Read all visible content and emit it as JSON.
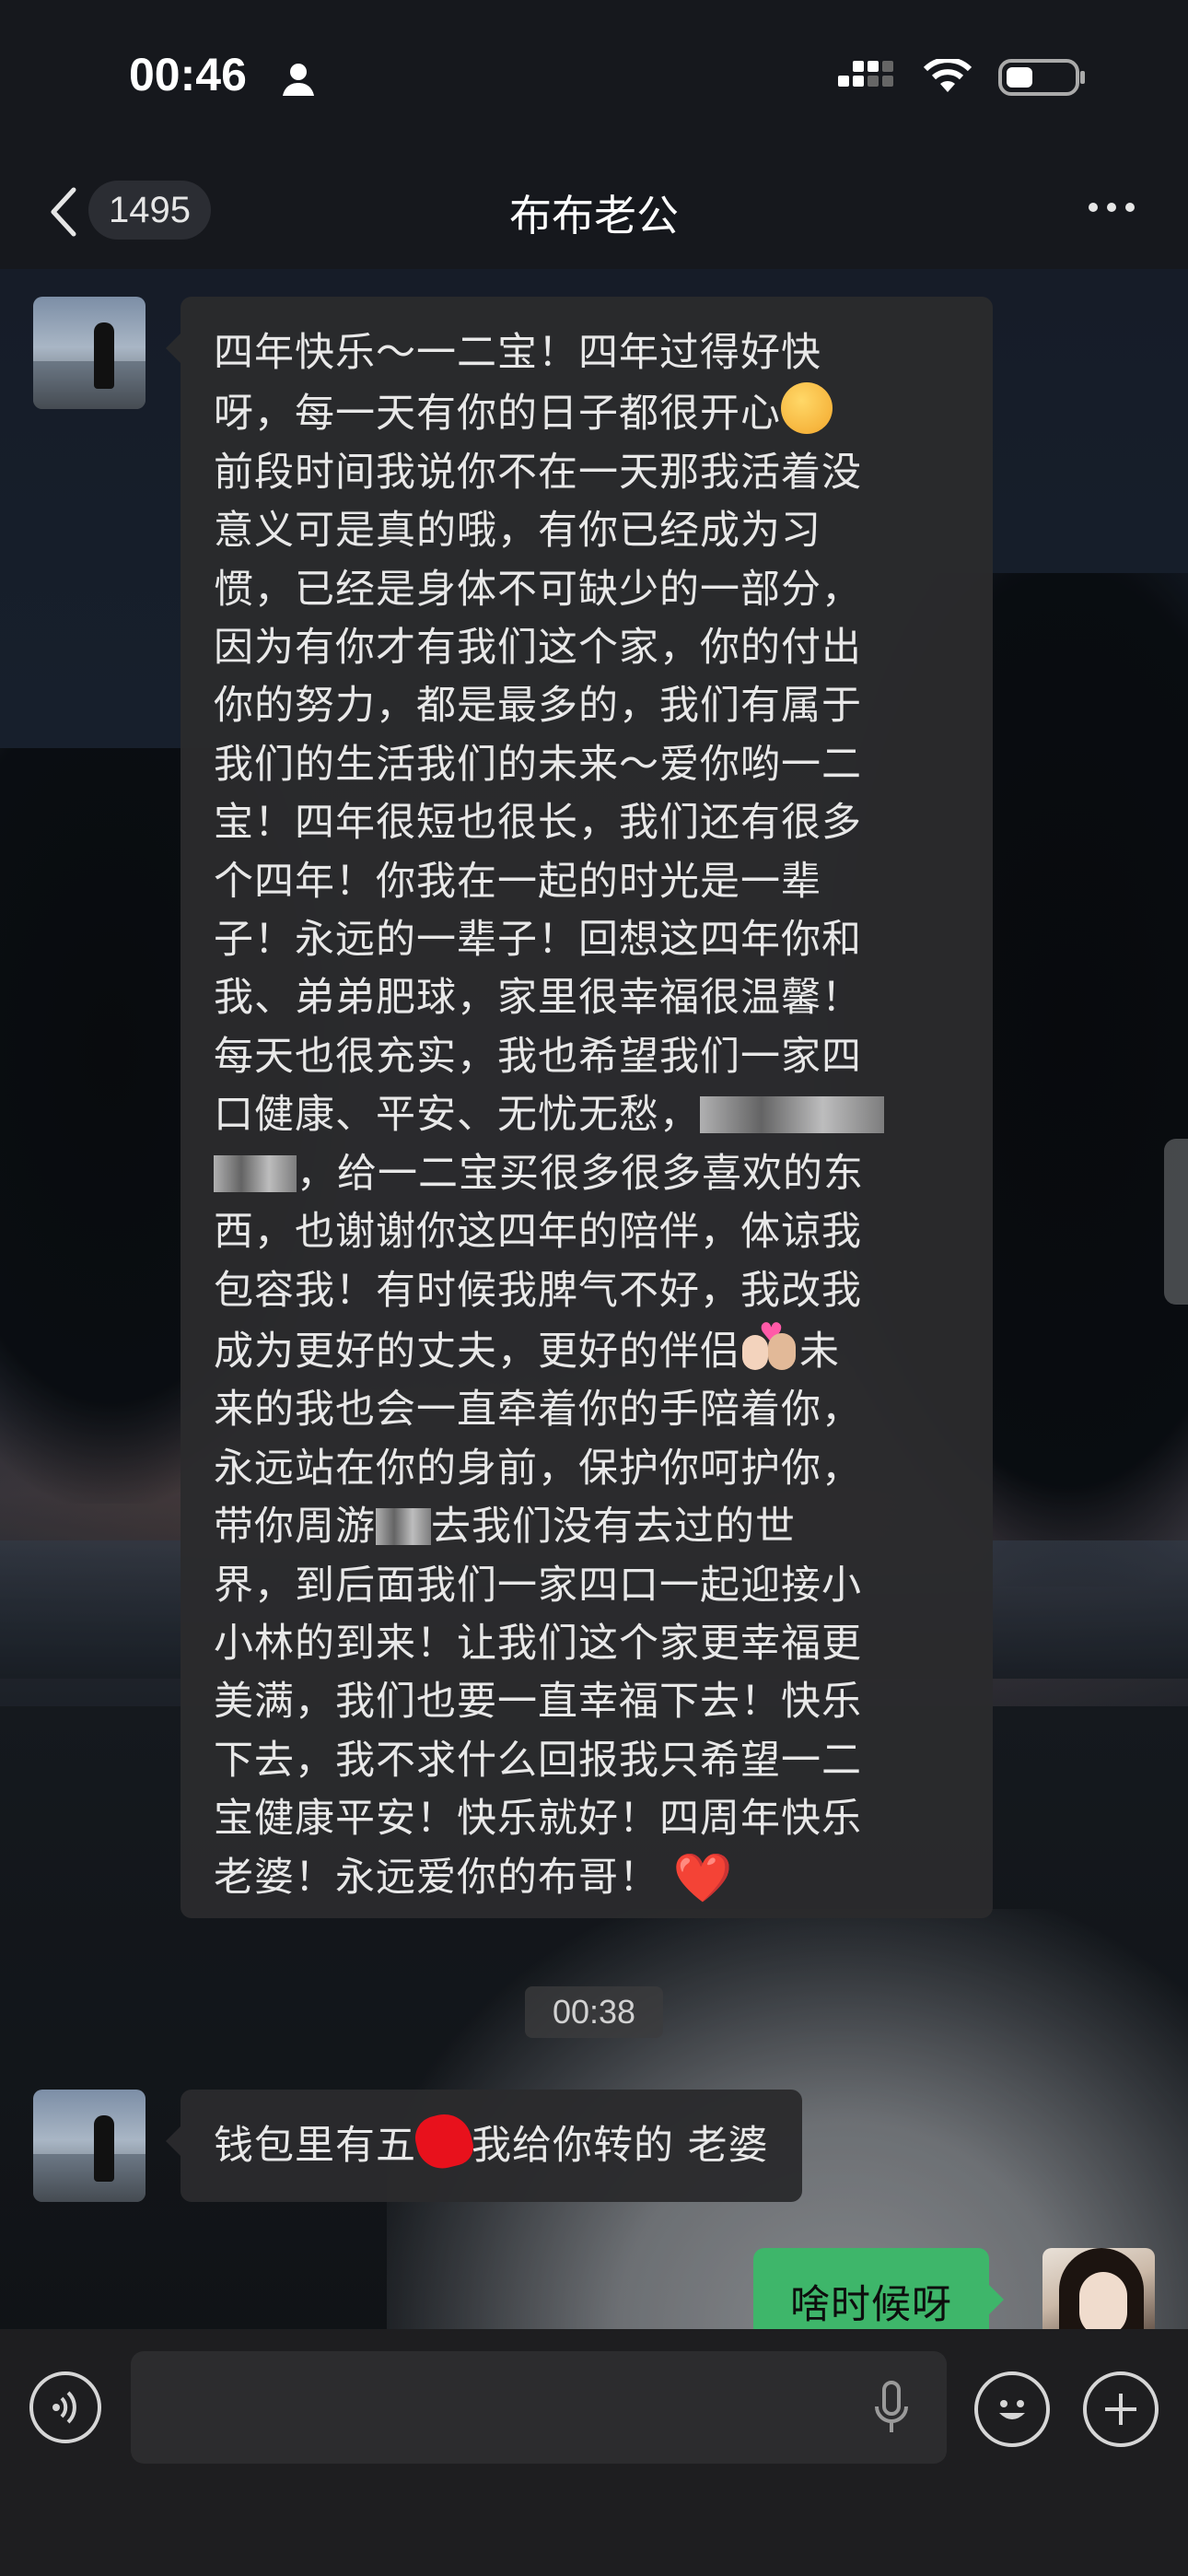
{
  "status_bar": {
    "time": "00:46"
  },
  "nav": {
    "back_count": "1495",
    "title": "布布老公"
  },
  "messages": {
    "long_lines": [
      "四年快乐～一二宝！四年过得好快",
      "呀，每一天有你的日子都很开心",
      "前段时间我说你不在一天那我活着没",
      "意义可是真的哦，有你已经成为习",
      "惯，已经是身体不可缺少的一部分，",
      "因为有你才有我们这个家，你的付出",
      "你的努力，都是最多的，我们有属于",
      "我们的生活我们的未来～爱你哟一二",
      "宝！四年很短也很长，我们还有很多",
      "个四年！你我在一起的时光是一辈",
      "子！永远的一辈子！回想这四年你和",
      "我、弟弟肥球，家里很幸福很温馨！",
      "每天也很充实，我也希望我们一家四",
      "口健康、平安、无忧无愁，",
      "，给一二宝买很多很多喜欢的东",
      "西，也谢谢你这四年的陪伴，体谅我",
      "包容我！有时候我脾气不好，我改我",
      "成为更好的丈夫，更好的伴侣",
      "未",
      "来的我也会一直牵着你的手陪着你，",
      "永远站在你的身前，保护你呵护你，",
      "带你周游",
      "去我们没有去过的世",
      "界，到后面我们一家四口一起迎接小",
      "小林的到来！让我们这个家更幸福更",
      "美满，我们也要一直幸福下去！快乐",
      "下去，我不求什么回报我只希望一二",
      "宝健康平安！快乐就好！四周年快乐",
      "老婆！永远爱你的布哥！"
    ],
    "emoji_heart": "❤️",
    "timestamp": "00:38",
    "short_part1": "钱包里有五",
    "short_part2": "我给你转的 老婆",
    "reply": "啥时候呀"
  },
  "icons": [
    "chevron-left-icon",
    "more-icon",
    "voice-icon",
    "mic-icon",
    "emoji-icon",
    "plus-icon",
    "person-icon",
    "signal-icon",
    "wifi-icon",
    "battery-icon"
  ]
}
